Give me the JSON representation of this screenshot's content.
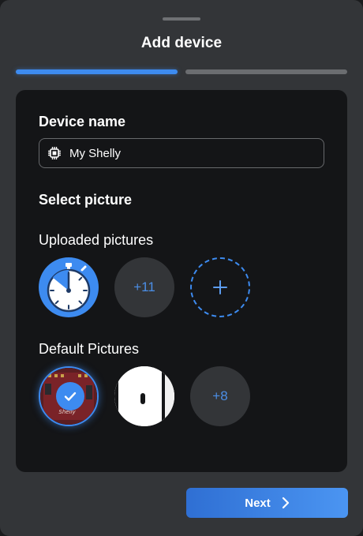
{
  "dialog": {
    "title": "Add device",
    "steps_total": 2,
    "current_step": 1
  },
  "device_name": {
    "label": "Device name",
    "value": "My Shelly",
    "icon": "chip-icon"
  },
  "picture": {
    "heading": "Select picture",
    "uploaded": {
      "label": "Uploaded pictures",
      "items": [
        "timer-icon"
      ],
      "more_count": "+11",
      "add_icon": "plus-icon"
    },
    "default": {
      "label": "Default Pictures",
      "items": [
        "shelly-pcb-image",
        "wall-switch-image"
      ],
      "selected_index": 0,
      "more_count": "+8"
    }
  },
  "footer": {
    "next_label": "Next"
  },
  "colors": {
    "accent": "#3d8bf0",
    "sheet_bg": "#333538",
    "card_bg": "#141517"
  }
}
